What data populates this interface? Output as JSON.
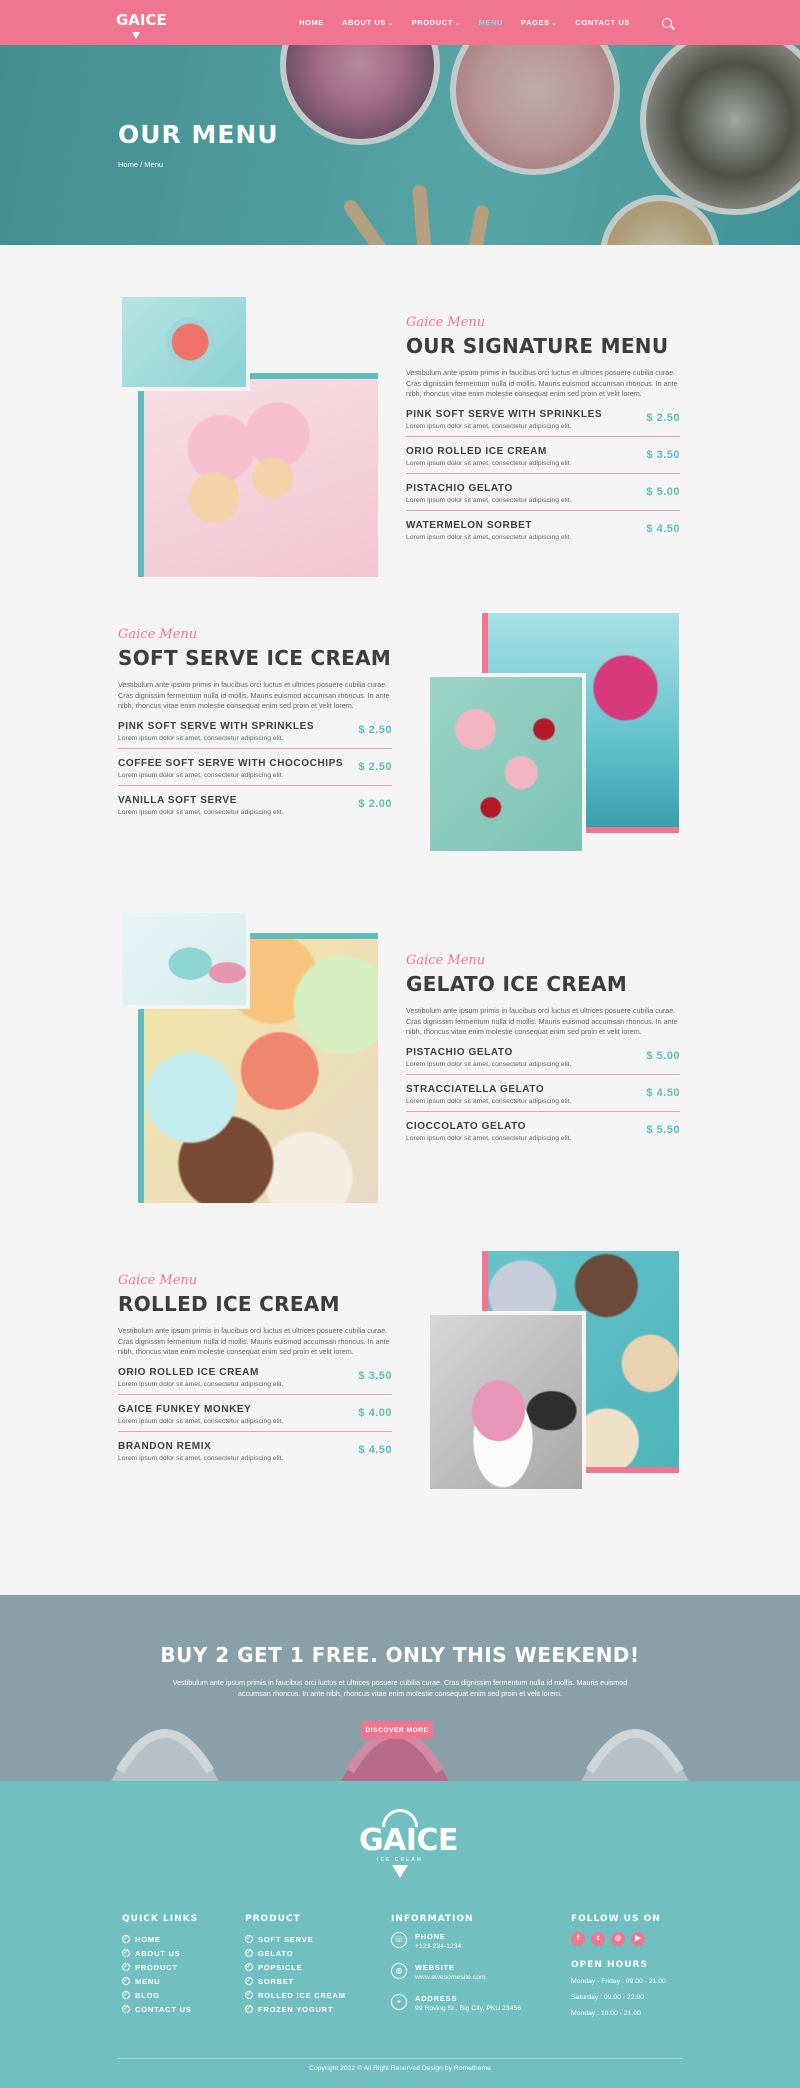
{
  "brand": {
    "logo_text": "GAICE",
    "logo_tag": "ICE CREAM"
  },
  "nav": {
    "items": [
      {
        "label": "HOME",
        "has_menu": false,
        "active": false
      },
      {
        "label": "ABOUT US",
        "has_menu": true,
        "active": false
      },
      {
        "label": "PRODUCT",
        "has_menu": true,
        "active": false
      },
      {
        "label": "MENU",
        "has_menu": false,
        "active": true
      },
      {
        "label": "PAGES",
        "has_menu": true,
        "active": false
      },
      {
        "label": "CONTACT US",
        "has_menu": false,
        "active": false
      }
    ],
    "search_icon": "search-icon"
  },
  "hero": {
    "title": "OUR MENU",
    "breadcrumb": "Home / Menu"
  },
  "script_label": "Gaice Menu",
  "desc": "Vestibulum ante ipsum primis in faucibus orci luctus et ultrices posuere cubilia curae. Cras dignissim fermentum nulla id mollis. Mauris euismod accumsan rhoncus. In ante nibh, rhoncus vitae enim molestie consequat enim sed proin et velit lorem.",
  "item_desc": "Lorem ipsum dolor sit amet, consectetur adipiscing elit.",
  "sections": [
    {
      "title": "OUR SIGNATURE MENU",
      "items": [
        {
          "name": "PINK SOFT SERVE WITH SPRINKLES",
          "price": "$ 2.50"
        },
        {
          "name": "ORIO ROLLED ICE CREAM",
          "price": "$ 3.50"
        },
        {
          "name": "PISTACHIO GELATO",
          "price": "$ 5.00"
        },
        {
          "name": "WATERMELON SORBET",
          "price": "$ 4.50"
        }
      ]
    },
    {
      "title": "SOFT SERVE ICE CREAM",
      "items": [
        {
          "name": "PINK SOFT SERVE WITH SPRINKLES",
          "price": "$ 2.50"
        },
        {
          "name": "COFFEE SOFT SERVE WITH CHOCOCHIPS",
          "price": "$ 2.50"
        },
        {
          "name": "VANILLA SOFT SERVE",
          "price": "$ 2.00"
        }
      ]
    },
    {
      "title": "GELATO ICE CREAM",
      "items": [
        {
          "name": "PISTACHIO GELATO",
          "price": "$ 5.00"
        },
        {
          "name": "STRACCIATELLA GELATO",
          "price": "$ 4.50"
        },
        {
          "name": "CIOCCOLATO GELATO",
          "price": "$ 5.50"
        }
      ]
    },
    {
      "title": "ROLLED ICE CREAM",
      "items": [
        {
          "name": "ORIO ROLLED ICE CREAM",
          "price": "$ 3.50"
        },
        {
          "name": "GAICE FUNKEY MONKEY",
          "price": "$ 4.00"
        },
        {
          "name": "BRANDON REMIX",
          "price": "$ 4.50"
        }
      ]
    }
  ],
  "promo": {
    "title": "BUY 2 GET 1 FREE. ONLY THIS WEEKEND!",
    "text": "Vestibulum ante ipsum primis in faucibus orci luctus et ultrices posuere cubilia curae. Cras dignissim fermentum nulla id mollis. Mauris euismod accumsan rhoncus. In ante nibh, rhoncus vitae enim molestie consequat enim sed proin et velit lorem.",
    "button": "DISCOVER MORE"
  },
  "footer": {
    "quick_links": {
      "heading": "QUICK LINKS",
      "links": [
        "HOME",
        "ABOUT US",
        "PRODUCT",
        "MENU",
        "BLOG",
        "CONTACT US"
      ]
    },
    "product": {
      "heading": "PRODUCT",
      "links": [
        "SOFT SERVE",
        "GELATO",
        "POPSICLE",
        "SORBET",
        "ROLLED ICE CREAM",
        "FROZEN YOGURT"
      ]
    },
    "information": {
      "heading": "INFORMATION",
      "entries": [
        {
          "icon": "phone-icon",
          "label": "PHONE",
          "value": "+123-234-1234"
        },
        {
          "icon": "globe-icon",
          "label": "WEBSITE",
          "value": "www.awesomesite.com"
        },
        {
          "icon": "location-pin-icon",
          "label": "ADDRESS",
          "value": "99 Roving St., Big City, PKU 23456"
        }
      ]
    },
    "follow": {
      "heading": "FOLLOW US ON",
      "icons": [
        "facebook-icon",
        "twitter-icon",
        "instagram-icon",
        "youtube-icon"
      ]
    },
    "hours": {
      "heading": "OPEN HOURS",
      "lines": [
        "Monday - Friday : 09.00 - 21.00",
        "Saturday : 09.00 - 22.00",
        "Monday : 10.00 - 21.00"
      ]
    },
    "copyright": "Copyright 2022 © All Right Reserved Design by Rometheme"
  },
  "colors": {
    "pink": "#f07590",
    "teal": "#5ebcbb",
    "footer": "#71bfc0",
    "promo": "#8aa0a8"
  }
}
